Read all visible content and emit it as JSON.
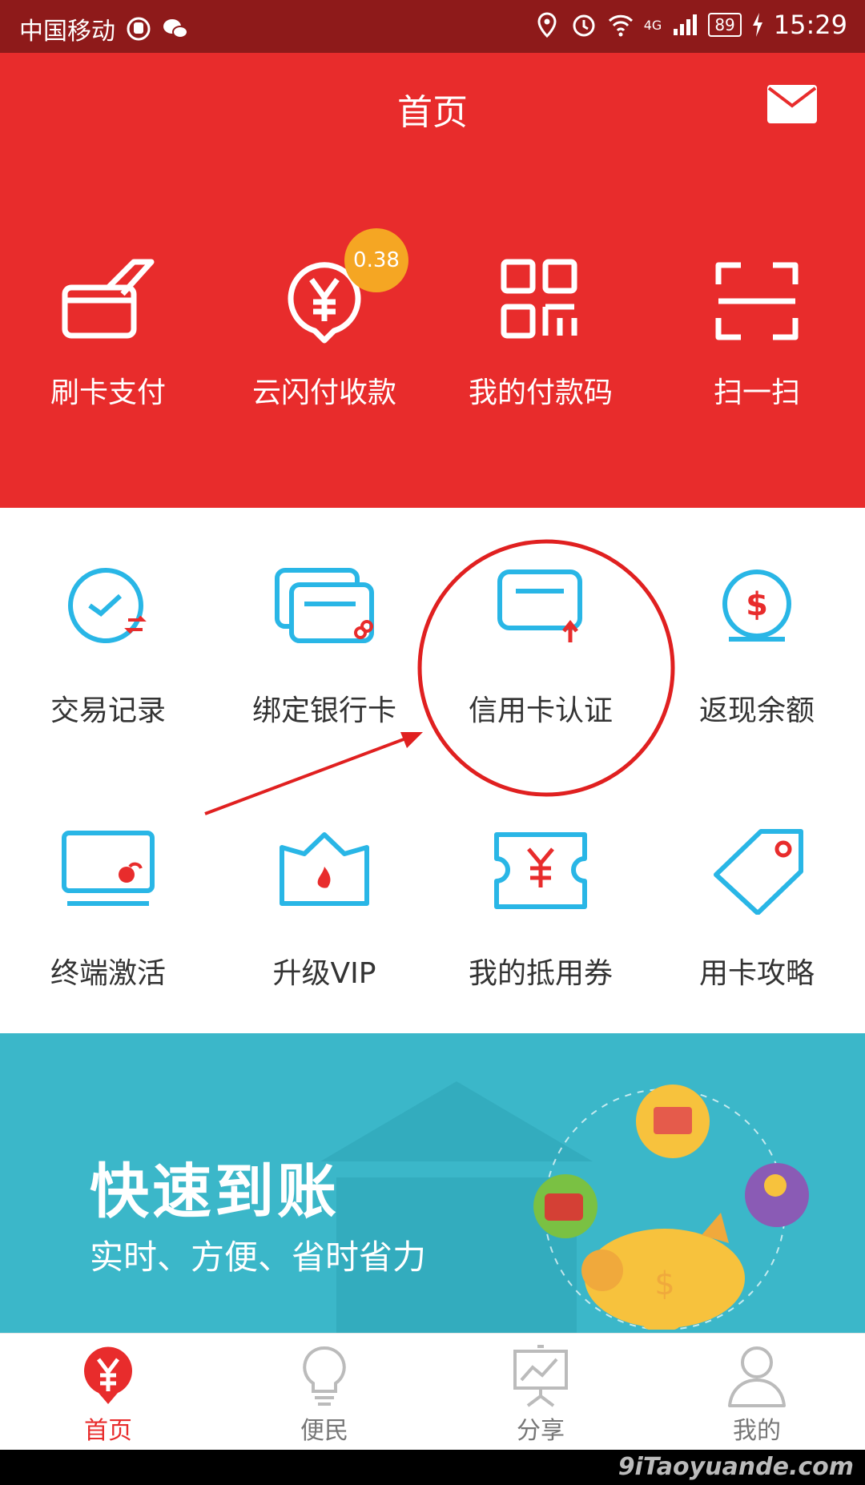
{
  "status_bar": {
    "carrier": "中国移动",
    "network": "4G",
    "battery": "89",
    "time": "15:29"
  },
  "header": {
    "title": "首页"
  },
  "quick_actions": [
    {
      "label": "刷卡支付"
    },
    {
      "label": "云闪付收款",
      "badge": "0.38"
    },
    {
      "label": "我的付款码"
    },
    {
      "label": "扫一扫"
    }
  ],
  "grid": {
    "row1": [
      {
        "label": "交易记录"
      },
      {
        "label": "绑定银行卡"
      },
      {
        "label": "信用卡认证"
      },
      {
        "label": "返现余额"
      }
    ],
    "row2": [
      {
        "label": "终端激活"
      },
      {
        "label": "升级VIP"
      },
      {
        "label": "我的抵用券"
      },
      {
        "label": "用卡攻略"
      }
    ]
  },
  "banner": {
    "title": "快速到账",
    "subtitle": "实时、方便、省时省力"
  },
  "bottom_nav": [
    {
      "label": "首页",
      "active": true
    },
    {
      "label": "便民"
    },
    {
      "label": "分享"
    },
    {
      "label": "我的"
    }
  ],
  "watermark": "9iTaoyuande.com",
  "colors": {
    "primary_red": "#e82c2c",
    "icon_blue": "#29b6e6",
    "banner_teal": "#3bb7c9",
    "badge_orange": "#f5a623"
  }
}
